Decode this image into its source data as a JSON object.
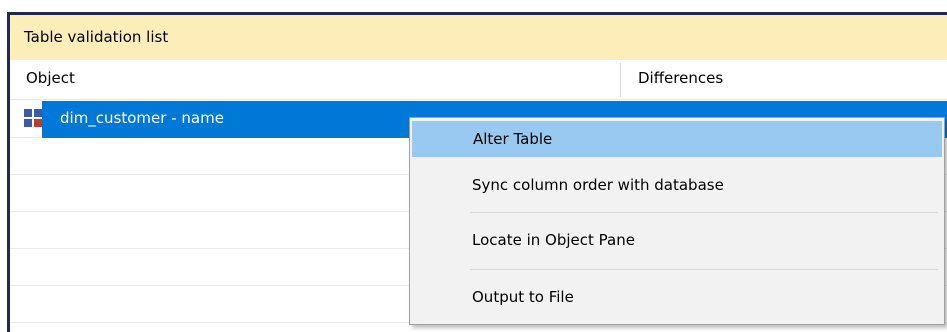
{
  "panel": {
    "title": "Table validation list"
  },
  "columns": {
    "object": "Object",
    "differences": "Differences"
  },
  "rows": [
    {
      "object": "dim_customer - name",
      "differences": "",
      "selected": true
    }
  ],
  "context_menu": {
    "items": [
      {
        "label": "Alter Table",
        "highlighted": true
      },
      {
        "label": "Sync column order with database"
      },
      {
        "label": "Locate in Object Pane"
      },
      {
        "label": "Output to File"
      }
    ]
  },
  "colors": {
    "title_bar": "#fcedb9",
    "selection": "#0078d7",
    "menu_highlight": "#99c9f1",
    "frame_border": "#1e2a52"
  },
  "icons": {
    "row_icon": "table-icon"
  }
}
